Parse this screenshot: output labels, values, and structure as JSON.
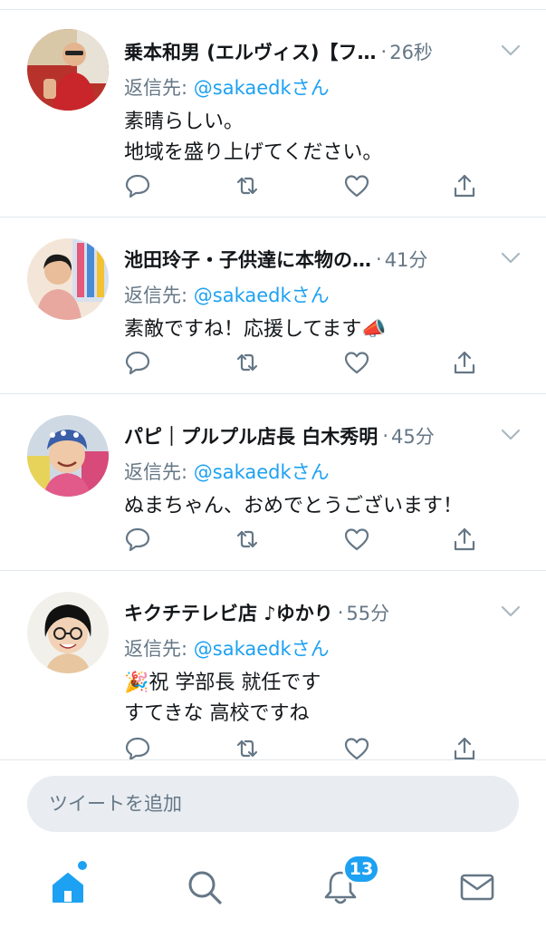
{
  "tweets": [
    {
      "name": "乗本和男 (エルヴィス)【フ…",
      "time": "26秒",
      "reply_prefix": "返信先: ",
      "reply_handle": "@sakaedkさん",
      "lines": [
        "素晴らしい。",
        "地域を盛り上げてください。"
      ],
      "avatar_icon": "avatar-photo"
    },
    {
      "name": "池田玲子・子供達に本物の…",
      "time": "41分",
      "reply_prefix": "返信先: ",
      "reply_handle": "@sakaedkさん",
      "lines": [
        "素敵ですね！応援してます📣"
      ],
      "avatar_icon": "avatar-photo"
    },
    {
      "name": "パピ｜プルプル店長 白木秀明",
      "time": "45分",
      "reply_prefix": "返信先: ",
      "reply_handle": "@sakaedkさん",
      "lines": [
        "ぬまちゃん、おめでとうございます！"
      ],
      "avatar_icon": "avatar-photo"
    },
    {
      "name": "キクチテレビ店 ♪ゆかり",
      "time": "55分",
      "reply_prefix": "返信先: ",
      "reply_handle": "@sakaedkさん",
      "lines": [
        "🎉祝 学部長 就任です",
        "すてきな 高校ですね"
      ],
      "avatar_icon": "avatar-photo"
    }
  ],
  "compose": {
    "placeholder": "ツイートを追加"
  },
  "tabbar": {
    "notifications_badge": "13",
    "items": [
      "home-icon",
      "search-icon",
      "notifications-icon",
      "messages-icon"
    ]
  },
  "colors": {
    "accent": "#1da1f2",
    "secondary_text": "#657786",
    "primary_text": "#14171a",
    "divider": "#e1e8ed"
  }
}
